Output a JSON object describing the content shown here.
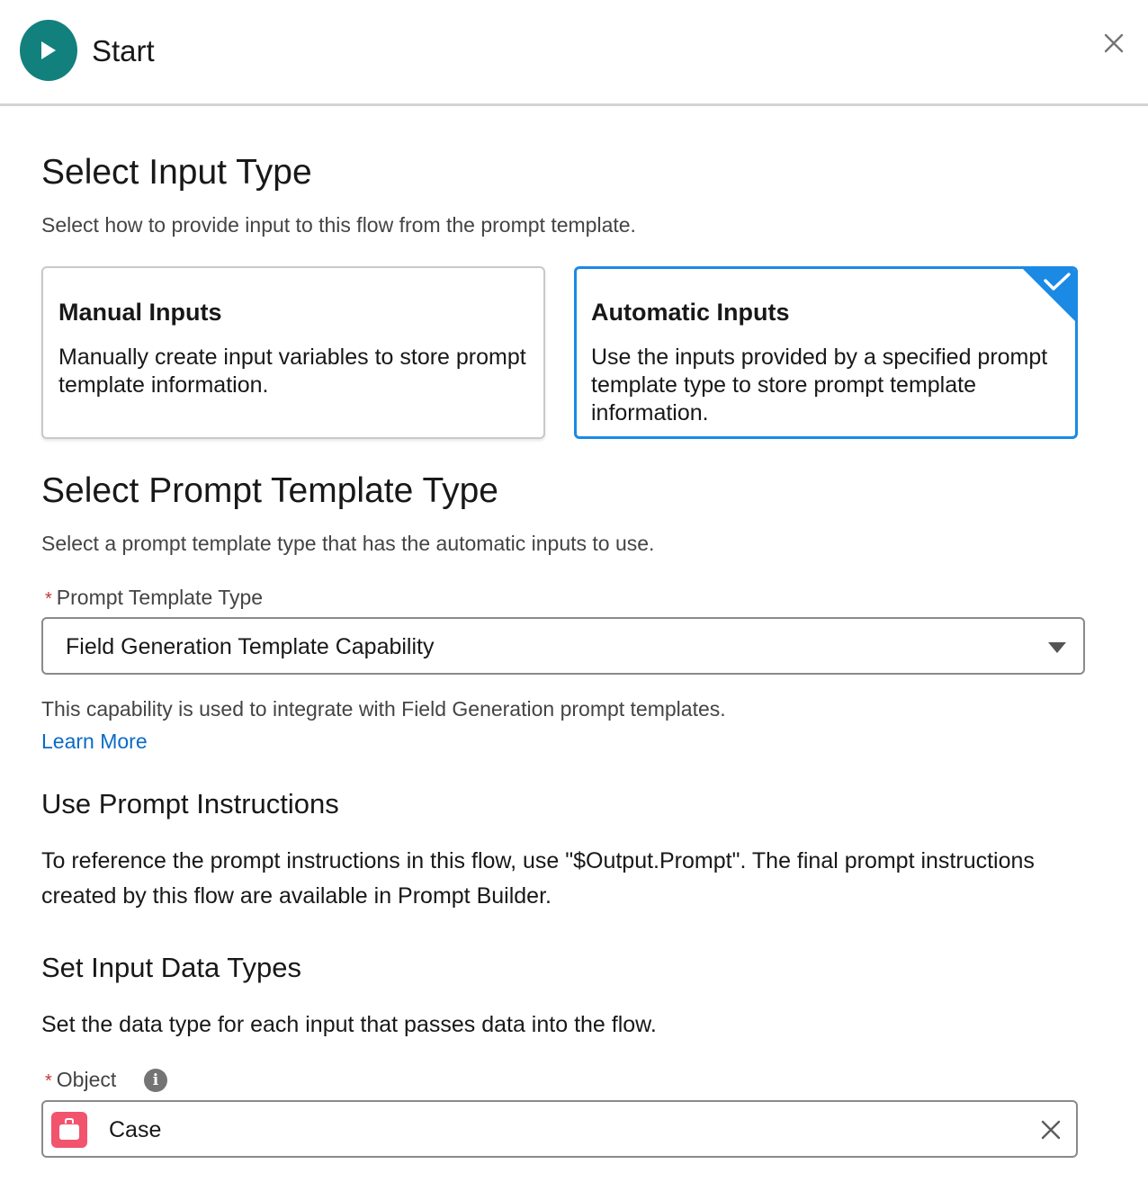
{
  "header": {
    "title": "Start"
  },
  "select_input_type": {
    "heading": "Select Input Type",
    "description": "Select how to provide input to this flow from the prompt template.",
    "options": [
      {
        "title": "Manual Inputs",
        "description": "Manually create input variables to store prompt template information.",
        "selected": false
      },
      {
        "title": "Automatic Inputs",
        "description": "Use the inputs provided by a specified prompt template type to store prompt template information.",
        "selected": true
      }
    ]
  },
  "prompt_template_type": {
    "heading": "Select Prompt Template Type",
    "description": "Select a prompt template type that has the automatic inputs to use.",
    "required_marker": "*",
    "label": "Prompt Template Type",
    "value": "Field Generation Template Capability",
    "help_text": "This capability is used to integrate with Field Generation prompt templates.",
    "learn_more": "Learn More"
  },
  "prompt_instructions": {
    "heading": "Use Prompt Instructions",
    "text": "To reference the prompt instructions in this flow, use \"$Output.Prompt\". The final prompt instructions created by this flow are available in Prompt Builder."
  },
  "input_data_types": {
    "heading": "Set Input Data Types",
    "description": "Set the data type for each input that passes data into the flow.",
    "required_marker": "*",
    "object_label": "Object",
    "info_glyph": "i",
    "object_value": "Case"
  },
  "colors": {
    "start_icon": "#12807d",
    "selected_border": "#1b8ae5",
    "link": "#0b6bc8",
    "required": "#c23934",
    "case_icon": "#f2536d"
  },
  "icons": {
    "start": "play-icon",
    "close": "close-icon",
    "selected": "checkmark-icon",
    "dropdown": "caret-down-icon",
    "info": "info-icon",
    "object": "case-briefcase-icon",
    "clear": "clear-icon"
  }
}
